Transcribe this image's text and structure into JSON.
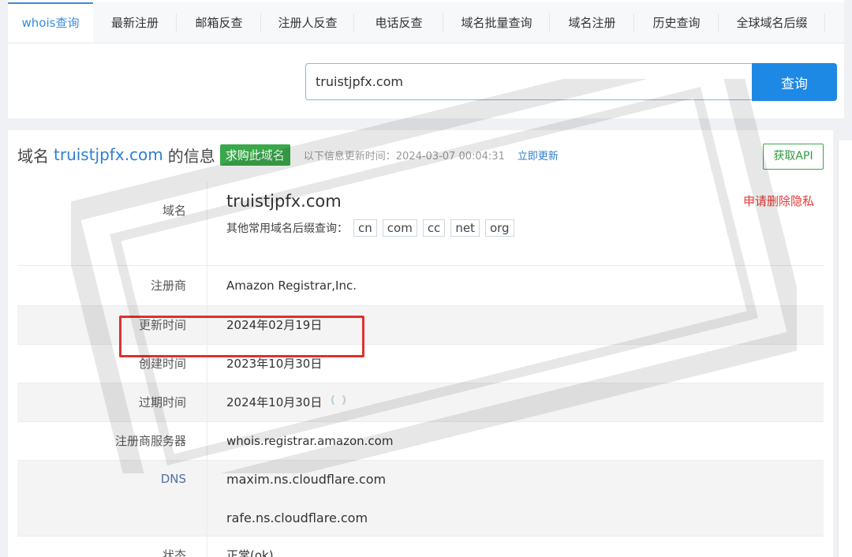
{
  "tabs": [
    {
      "label": "whois查询",
      "active": true
    },
    {
      "label": "最新注册"
    },
    {
      "label": "邮箱反查"
    },
    {
      "label": "注册人反查"
    },
    {
      "label": "电话反查"
    },
    {
      "label": "域名批量查询"
    },
    {
      "label": "域名注册"
    },
    {
      "label": "历史查询"
    },
    {
      "label": "全球域名后缀"
    }
  ],
  "search": {
    "value": "truistjpfx.com",
    "button_label": "查询"
  },
  "header": {
    "prefix": "域名",
    "domain": "truistjpfx.com",
    "suffix": "的信息",
    "buy_label": "求购此域名",
    "updated_label": "以下信息更新时间：2024-03-07 00:04:31",
    "update_now_label": "立即更新",
    "api_label": "获取API"
  },
  "rows": {
    "domain": {
      "label": "域名",
      "value": "truistjpfx.com",
      "privacy_label": "申请删除隐私",
      "suffix_prompt": "其他常用域名后缀查询：",
      "suffixes": [
        "cn",
        "com",
        "cc",
        "net",
        "org"
      ]
    },
    "registrar": {
      "label": "注册商",
      "value": "Amazon Registrar,Inc."
    },
    "updated": {
      "label": "更新时间",
      "value": "2024年02月19日"
    },
    "created": {
      "label": "创建时间",
      "value": "2023年10月30日"
    },
    "expires": {
      "label": "过期时间",
      "value": "2024年10月30日"
    },
    "whois_server": {
      "label": "注册商服务器",
      "value": "whois.registrar.amazon.com"
    },
    "dns": {
      "label": "DNS",
      "values": [
        "maxim.ns.cloudflare.com",
        "rafe.ns.cloudflare.com"
      ]
    },
    "status": {
      "label": "状态",
      "value": "正常(ok)"
    }
  },
  "icons": {
    "refresh": "refresh-icon"
  },
  "colors": {
    "accent": "#1e88e5",
    "link": "#2f7fd0",
    "buy": "#3aa74a",
    "danger": "#e53935",
    "highlight": "#e03030"
  }
}
